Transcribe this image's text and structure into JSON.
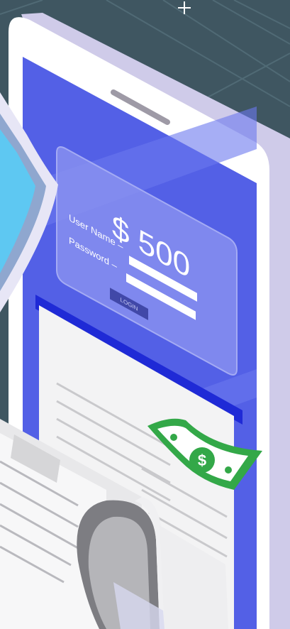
{
  "card": {
    "amount": "$ 500",
    "username_label": "User Name –",
    "password_label": "Password –",
    "login_button": "LOGIN"
  },
  "icons": [
    "sparkle-icon",
    "shield-icon",
    "dollar-bill-icon",
    "receipt-icon"
  ],
  "colors": {
    "background": "#3f5661",
    "phone_body": "#ffffff",
    "phone_side": "#cfcbe9",
    "screen": "#5360e6",
    "shield": "#5ec8f2",
    "bill": "#33a848",
    "paper": "#f3f3f4"
  }
}
